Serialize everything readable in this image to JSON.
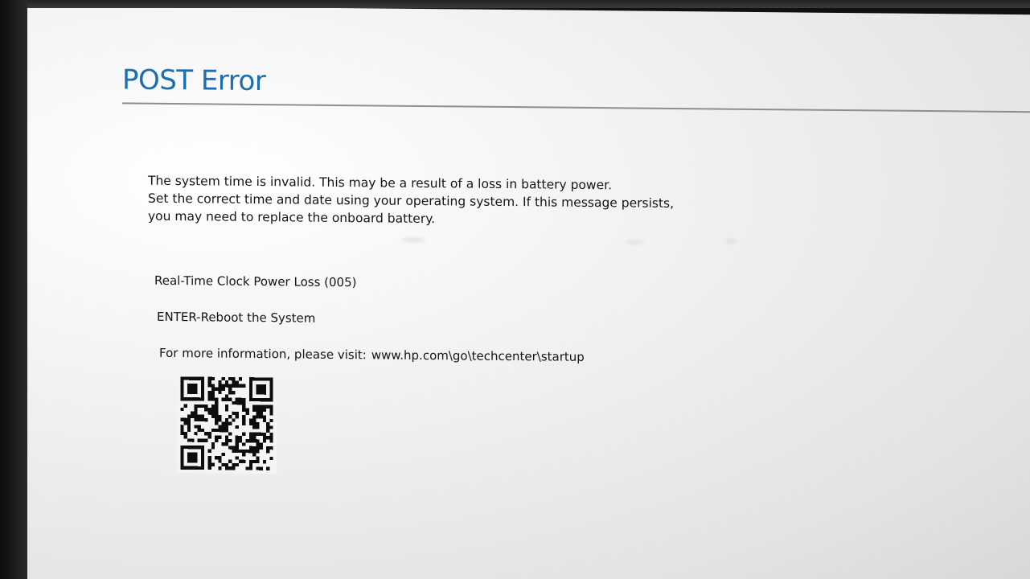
{
  "screen": {
    "title": "POST Error",
    "message_lines": [
      "The system time is invalid. This may be a result of a loss in battery power.",
      "Set the correct time and date using your operating system. If this message persists,",
      "you may need to replace the onboard battery."
    ],
    "error_code": "Real-Time Clock Power Loss (005)",
    "enter_action": "ENTER-Reboot the System",
    "info_label": "For more information, please visit:",
    "info_url": "www.hp.com\\go\\techcenter\\startup",
    "qr_code_icon": "qr-code-icon"
  },
  "colors": {
    "title": "#1c6fae",
    "text": "#141414",
    "background": "#f1f1f1",
    "rule": "#8a8f93"
  }
}
